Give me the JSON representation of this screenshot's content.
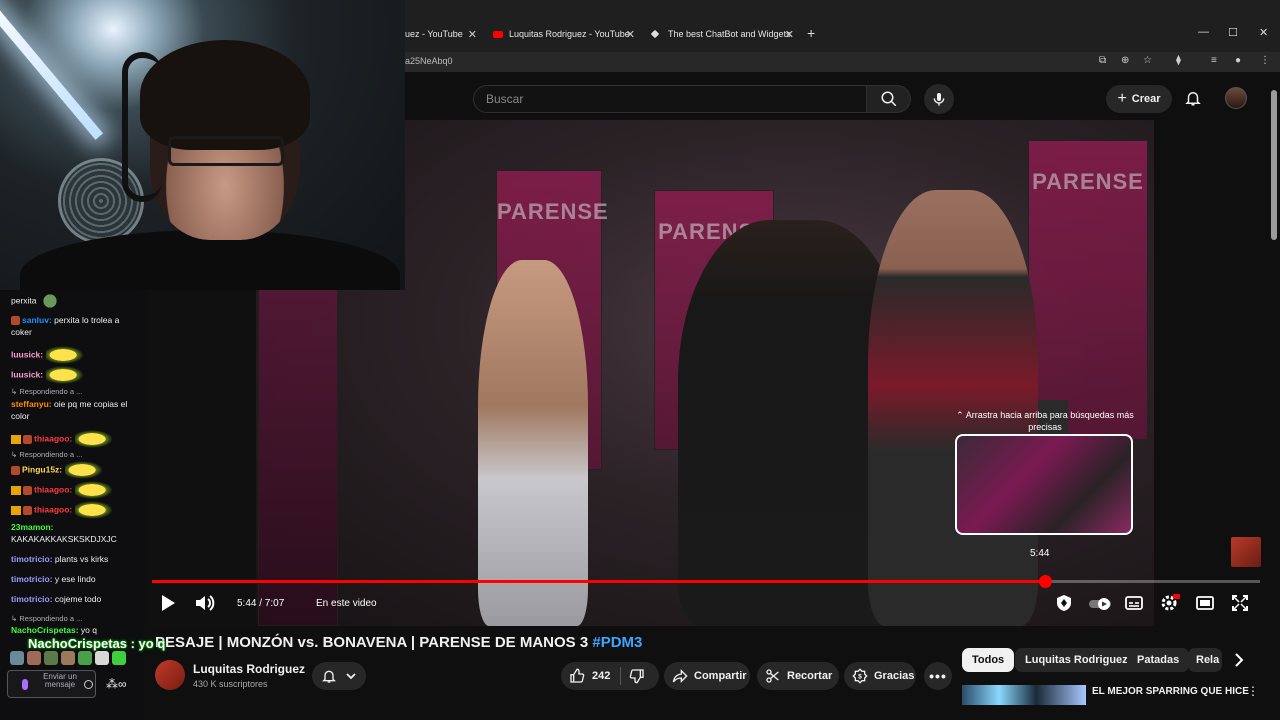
{
  "browser": {
    "tabs": [
      {
        "label": "uez - YouTube"
      },
      {
        "label": "Luquitas Rodriguez - YouTube"
      },
      {
        "label": "The best ChatBot and Widgets"
      }
    ],
    "url": "a25NeAbq0"
  },
  "header": {
    "search_placeholder": "Buscar",
    "create_label": "Crear"
  },
  "player": {
    "preview_hint": "⌃ Arrastra hacia arriba para búsquedas más precisas",
    "preview_time": "5:44",
    "time_display": "5:44 / 7:07",
    "chapter_label": "En este video",
    "progress": 0.806,
    "controls": [
      "play-icon",
      "volume-icon",
      "shield-icon",
      "autoplay-toggle",
      "subtitles-icon",
      "settings-icon",
      "theater-icon",
      "fullscreen-icon"
    ]
  },
  "video": {
    "title": "PESAJE | MONZÓN vs. BONAVENA | PARENSE DE MANOS 3",
    "hashtag": "#PDM3",
    "banner_text": "PARENSE"
  },
  "channel": {
    "name": "Luquitas Rodriguez",
    "subscribers": "430 K suscriptores"
  },
  "actions": {
    "likes": "242",
    "share": "Compartir",
    "clip": "Recortar",
    "thanks": "Gracias"
  },
  "chips": [
    "Todos",
    "Luquitas Rodriguez",
    "Patadas",
    "Rela"
  ],
  "related": {
    "title": "EL MEJOR SPARRING QUE HICE"
  },
  "chat": {
    "messages": [
      {
        "user": "",
        "text": "perxita"
      },
      {
        "user": "sanluv:",
        "text": " perxita lo trolea a coker"
      },
      {
        "user": "luusick:",
        "text": ""
      },
      {
        "user": "luusick:",
        "text": ""
      },
      {
        "reply": "Respondiendo a ..."
      },
      {
        "user": "steffanyu:",
        "text": " oie pq me copias el color"
      },
      {
        "user": "thiaagoo:",
        "text": ""
      },
      {
        "reply": "Respondiendo a ..."
      },
      {
        "user": "Pingu15z:",
        "text": ""
      },
      {
        "user": "thiaagoo:",
        "text": ""
      },
      {
        "user": "thiaagoo:",
        "text": ""
      },
      {
        "user": "23mamon:",
        "text": " KAKAKAKKAKSKSKDJXJC"
      },
      {
        "user": "timotricio:",
        "text": " plants vs kirks"
      },
      {
        "user": "timotricio:",
        "text": " y ese lindo"
      },
      {
        "user": "timotricio:",
        "text": " cojeme todo"
      },
      {
        "reply": "Respondiendo a ..."
      },
      {
        "user": "NachoCrispetas:",
        "text": " yo q"
      }
    ],
    "overlay_name": "NachoCrispetas : yo q",
    "input_placeholder": "Enviar un mensaje",
    "colors": {
      "sanluv": "#1e90ff",
      "luusick": "#ff9bd0",
      "steffanyu": "#ff8c00",
      "thiaagoo": "#ff3b3b",
      "pingu": "#ffd84a",
      "mamon": "#3eff3e",
      "timotricio": "#9b9bff",
      "nacho": "#3eff3e"
    }
  }
}
